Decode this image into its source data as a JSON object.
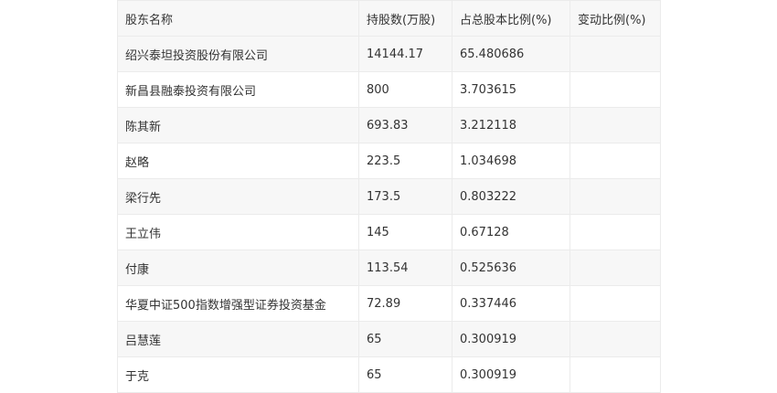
{
  "table": {
    "headers": [
      "股东名称",
      "持股数(万股)",
      "占总股本比例(%)",
      "变动比例(%)"
    ],
    "rows": [
      [
        "绍兴泰坦投资股份有限公司",
        "14144.17",
        "65.480686",
        ""
      ],
      [
        "新昌县融泰投资有限公司",
        "800",
        "3.703615",
        ""
      ],
      [
        "陈其新",
        "693.83",
        "3.212118",
        ""
      ],
      [
        "赵略",
        "223.5",
        "1.034698",
        ""
      ],
      [
        "梁行先",
        "173.5",
        "0.803222",
        ""
      ],
      [
        "王立伟",
        "145",
        "0.67128",
        ""
      ],
      [
        "付康",
        "113.54",
        "0.525636",
        ""
      ],
      [
        "华夏中证500指数增强型证券投资基金",
        "72.89",
        "0.337446",
        ""
      ],
      [
        "吕慧莲",
        "65",
        "0.300919",
        ""
      ],
      [
        "于克",
        "65",
        "0.300919",
        ""
      ]
    ]
  }
}
